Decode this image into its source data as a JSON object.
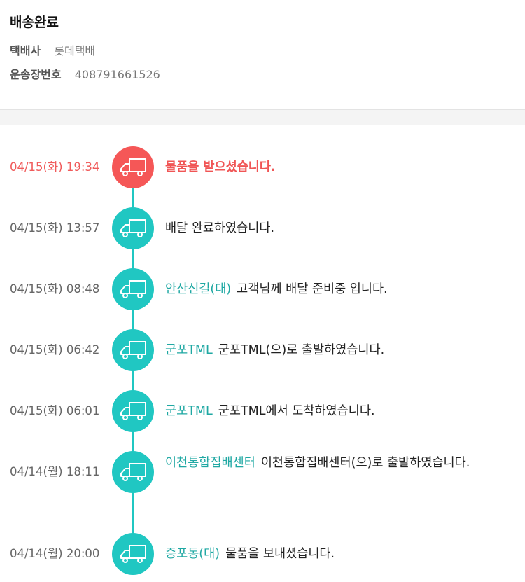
{
  "delivery": {
    "status_title": "배송완료",
    "courier_label": "택배사",
    "courier_value": "롯데택배",
    "tracking_label": "운송장번호",
    "tracking_value": "408791661526"
  },
  "timeline": [
    {
      "time": "04/15(화) 19:34",
      "place": "",
      "message": "물품을 받으셨습니다.",
      "current": true
    },
    {
      "time": "04/15(화) 13:57",
      "place": "",
      "message": "배달 완료하였습니다.",
      "current": false
    },
    {
      "time": "04/15(화) 08:48",
      "place": "안산신길(대)",
      "message": "고객님께 배달 준비중 입니다.",
      "current": false
    },
    {
      "time": "04/15(화) 06:42",
      "place": "군포TML",
      "message": "군포TML(으)로 출발하였습니다.",
      "current": false
    },
    {
      "time": "04/15(화) 06:01",
      "place": "군포TML",
      "message": "군포TML에서 도착하였습니다.",
      "current": false
    },
    {
      "time": "04/14(월) 18:11",
      "place": "이천통합집배센터",
      "message": "이천통합집배센터(으)로 출발하였습니다.",
      "current": false
    },
    {
      "time": "04/14(월) 20:00",
      "place": "증포동(대)",
      "message": "물품을 보내셨습니다.",
      "current": false
    }
  ],
  "colors": {
    "accent": "#20c7c2",
    "place_text": "#1fa8a3",
    "current": "#f55757"
  },
  "icons": {
    "timeline_node": "delivery-truck-icon"
  }
}
